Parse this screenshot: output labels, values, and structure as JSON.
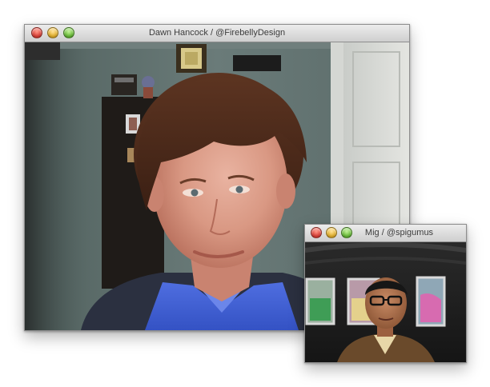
{
  "main_window": {
    "title": "Dawn Hancock / @FirebellyDesign",
    "video_label": "Dawn Hancock video feed"
  },
  "pip_window": {
    "title": "Mig / @spigumus",
    "video_label": "Mig video feed"
  },
  "colors": {
    "close": "#e0453c",
    "minimize": "#e8b632",
    "zoom": "#6ec13c",
    "wall": "#5f7170",
    "shirt": "#3f5fd1"
  }
}
